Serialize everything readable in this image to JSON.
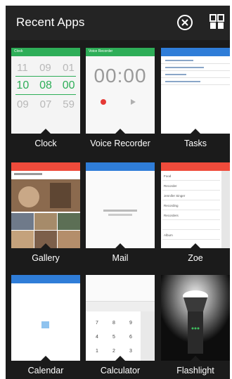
{
  "header": {
    "title": "Recent Apps"
  },
  "colors": {
    "clock": "#2eae58",
    "voice_recorder": "#2eae58",
    "tasks": "#2f7dd8",
    "gallery": "#ef4b3b",
    "mail": "#2f7dd8",
    "zoe": "#ef4b3b",
    "calendar": "#2f7dd8"
  },
  "apps": [
    {
      "label": "Clock",
      "icon": "clock-icon",
      "preview": {
        "rows_dim_top": [
          "11",
          "09",
          "01"
        ],
        "rows_active": [
          "10",
          "08",
          "00"
        ],
        "rows_dim_bottom": [
          "09",
          "07",
          "59"
        ]
      }
    },
    {
      "label": "Voice Recorder",
      "icon": "microphone-icon",
      "preview": {
        "time": "00:00"
      }
    },
    {
      "label": "Tasks",
      "icon": "check-icon"
    },
    {
      "label": "Gallery",
      "icon": "image-icon"
    },
    {
      "label": "Mail",
      "icon": "mail-icon"
    },
    {
      "label": "Zoe",
      "icon": "zoe-icon",
      "preview": {
        "items": [
          "Food",
          "Recorder",
          "Jennifer Singer",
          "Recording",
          "Recorders",
          "",
          "Album"
        ]
      }
    },
    {
      "label": "Calendar",
      "icon": "calendar-icon"
    },
    {
      "label": "Calculator",
      "icon": "calculator-icon",
      "preview": {
        "keys": [
          "7",
          "8",
          "9",
          "4",
          "5",
          "6",
          "1",
          "2",
          "3"
        ]
      }
    },
    {
      "label": "Flashlight",
      "icon": "flashlight-icon"
    }
  ]
}
